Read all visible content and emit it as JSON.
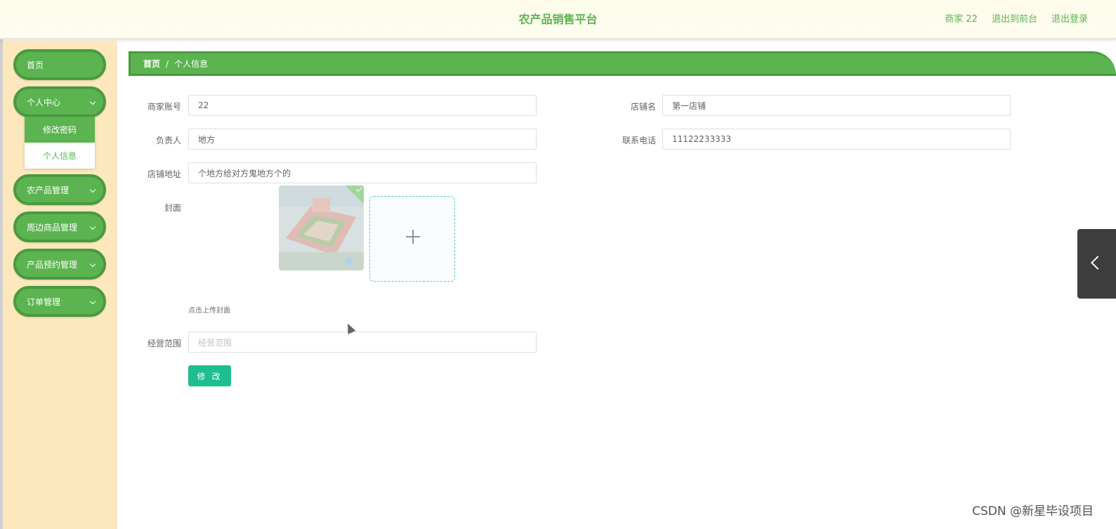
{
  "header": {
    "title": "农产品销售平台",
    "user_label": "商家 22",
    "to_frontend": "退出到前台",
    "logout": "退出登录"
  },
  "sidebar": {
    "items": [
      {
        "label": "首页"
      },
      {
        "label": "个人中心"
      },
      {
        "label": "农产品管理"
      },
      {
        "label": "周边商品管理"
      },
      {
        "label": "产品预约管理"
      },
      {
        "label": "订单管理"
      }
    ],
    "submenu": [
      {
        "label": "修改密码",
        "active": true
      },
      {
        "label": "个人信息",
        "active": false
      }
    ]
  },
  "breadcrumb": {
    "home": "首页",
    "separator": "/",
    "current": "个人信息"
  },
  "form": {
    "merchant_account": {
      "label": "商家账号",
      "value": "22"
    },
    "shop_name": {
      "label": "店铺名",
      "value": "第一店铺"
    },
    "manager": {
      "label": "负责人",
      "value": "地方"
    },
    "phone": {
      "label": "联系电话",
      "value": "11122233333"
    },
    "address": {
      "label": "店铺地址",
      "value": "个地方给对方鬼地方个的"
    },
    "cover": {
      "label": "封面",
      "hint": "点击上传封面"
    },
    "business_scope": {
      "label": "经营范围",
      "placeholder": "经营范围"
    },
    "submit_label": "修 改"
  },
  "watermark": "CSDN @新星毕设项目",
  "colors": {
    "primary_green": "#5bb450",
    "sidebar_bg": "#fde8bd",
    "submit_teal": "#1dbe8f"
  }
}
